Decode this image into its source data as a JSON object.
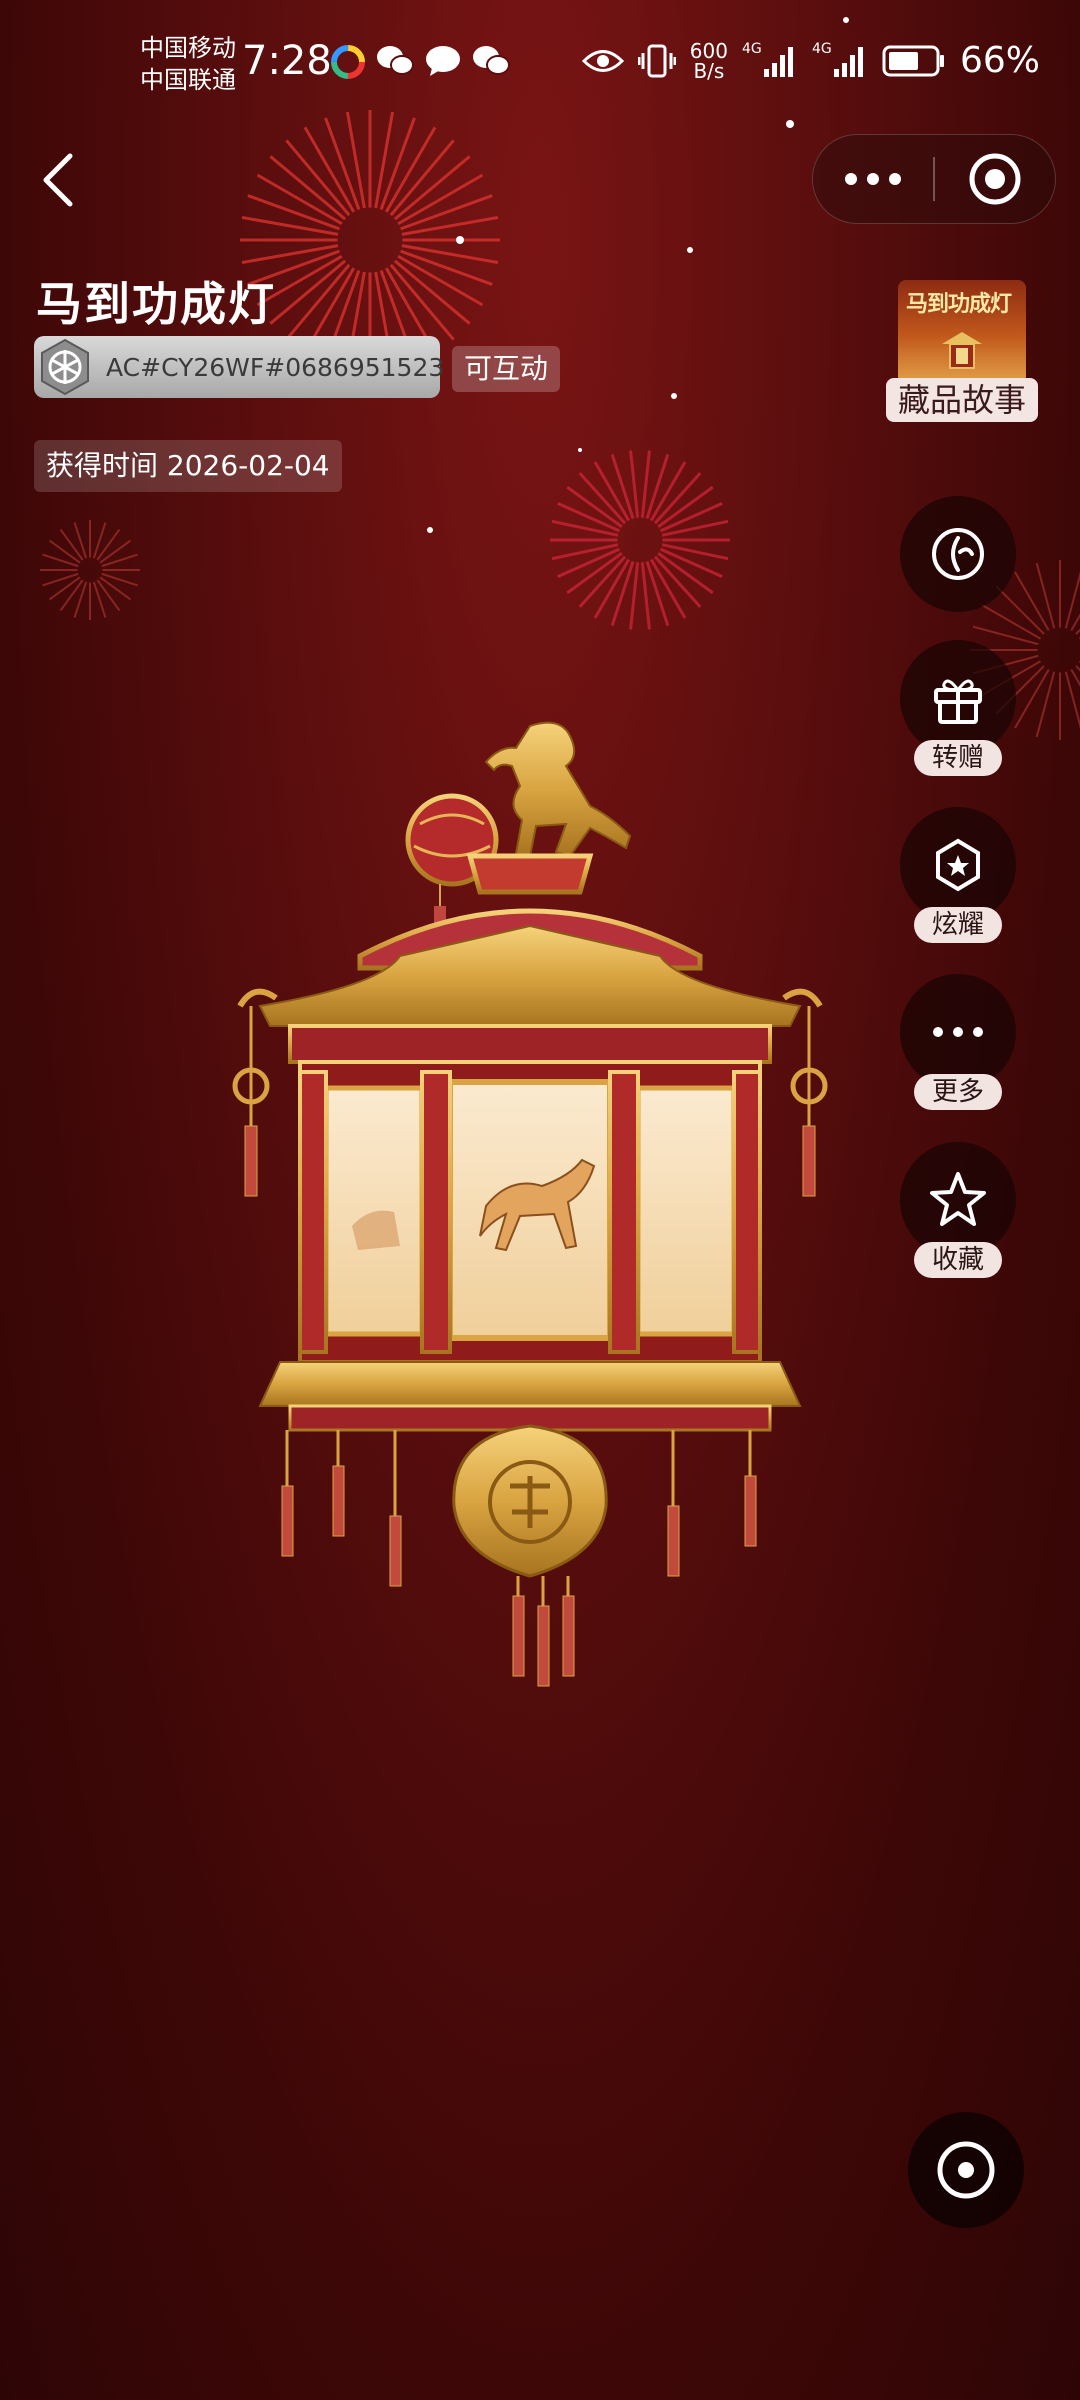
{
  "status_bar": {
    "carrier_1": "中国移动",
    "carrier_2": "中国联通",
    "time": "7:28",
    "net_speed_value": "600",
    "net_speed_unit": "B/s",
    "network_1": "4G",
    "network_2": "4G",
    "battery": "66%",
    "battery_level": 0.66
  },
  "item": {
    "title": "马到功成灯",
    "code": "AC#CY26WF#0686951523",
    "interact_tag": "可互动",
    "acquired": "获得时间 2026-02-04"
  },
  "story": {
    "thumb_title": "马到功成灯",
    "label": "藏品故事"
  },
  "actions": {
    "transfer": "转赠",
    "show_off": "炫耀",
    "more": "更多",
    "favorite": "收藏"
  },
  "colors": {
    "background": "#5c0e0e",
    "gold": "#d9a441",
    "lantern_red": "#8f1b1b"
  }
}
